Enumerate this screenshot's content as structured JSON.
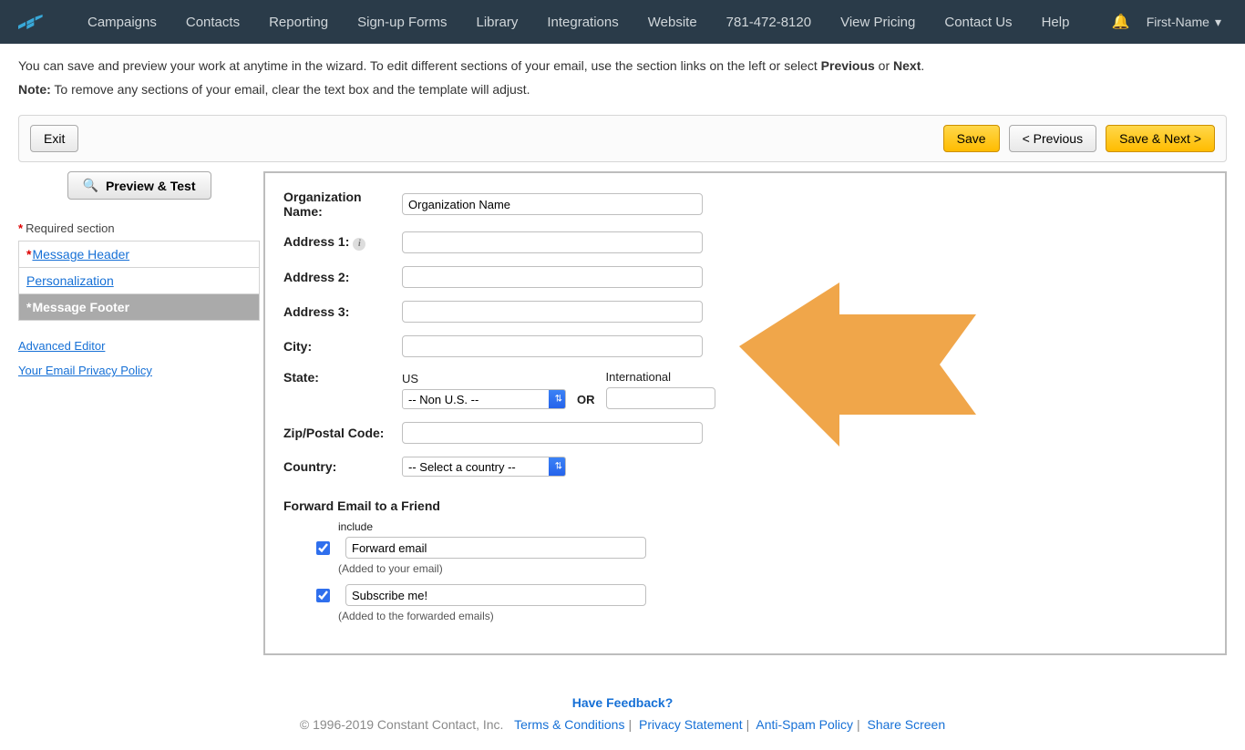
{
  "nav": {
    "items": [
      "Campaigns",
      "Contacts",
      "Reporting",
      "Sign-up Forms",
      "Library",
      "Integrations",
      "Website",
      "781-472-8120",
      "View Pricing",
      "Contact Us",
      "Help"
    ],
    "user": "First-Name"
  },
  "intro": {
    "line1_pre": "You can save and preview your work at anytime in the wizard. To edit different sections of your email, use the section links on the left or select ",
    "prev": "Previous",
    "or": " or ",
    "next": "Next",
    "period": ".",
    "note_label": "Note:",
    "note_text": " To remove any sections of your email, clear the text box and the template will adjust."
  },
  "toolbar": {
    "exit": "Exit",
    "save": "Save",
    "previous": "< Previous",
    "save_next": "Save & Next >"
  },
  "sidebar": {
    "preview": "Preview & Test",
    "required": "Required section",
    "sections": [
      {
        "label": "Message Header",
        "required": true,
        "active": false
      },
      {
        "label": "Personalization",
        "required": false,
        "active": false
      },
      {
        "label": "Message Footer",
        "required": true,
        "active": true
      }
    ],
    "links": [
      "Advanced Editor",
      "Your Email Privacy Policy"
    ]
  },
  "form": {
    "org_label": "Organization Name:",
    "org_value": "Organization Name",
    "addr1": "Address 1:",
    "addr2": "Address 2:",
    "addr3": "Address 3:",
    "city": "City:",
    "state": "State:",
    "state_us": "US",
    "state_intl": "International",
    "state_select": "-- Non U.S. --",
    "or": "OR",
    "zip": "Zip/Postal Code:",
    "country": "Country:",
    "country_select": "-- Select a country --",
    "forward_header": "Forward Email to a Friend",
    "include": "include",
    "fwd_value": "Forward email",
    "fwd_hint": "(Added to your email)",
    "sub_value": "Subscribe me!",
    "sub_hint": "(Added to the forwarded emails)"
  },
  "footer": {
    "feedback": "Have Feedback?",
    "copyright": "© 1996-2019 Constant Contact, Inc.",
    "links": [
      "Terms & Conditions",
      "Privacy Statement",
      "Anti-Spam Policy",
      "Share Screen"
    ]
  }
}
